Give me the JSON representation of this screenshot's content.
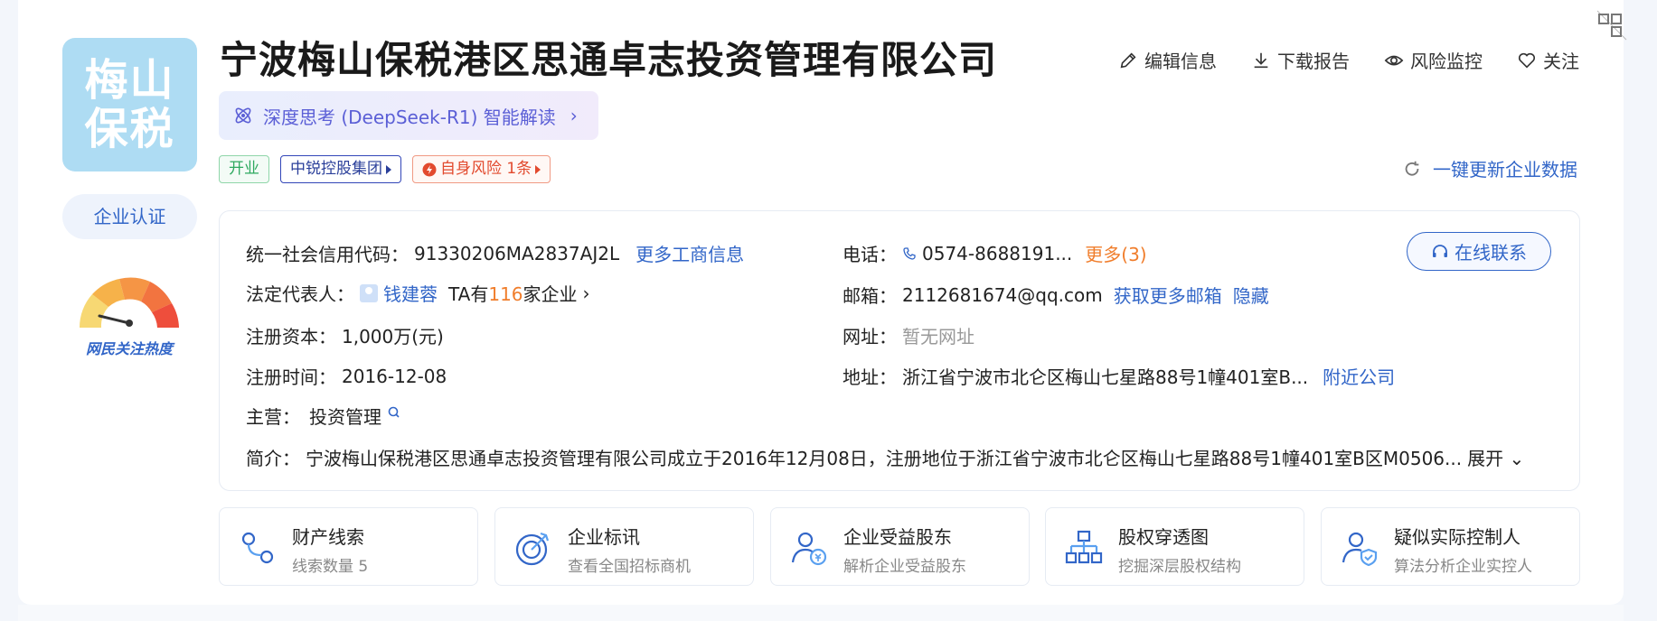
{
  "company": {
    "logo_text_line1": "梅山",
    "logo_text_line2": "保税",
    "name": "宁波梅山保税港区思通卓志投资管理有限公司",
    "certification": "企业认证",
    "heat_label": "网民关注热度"
  },
  "actions": {
    "edit": "编辑信息",
    "download": "下载报告",
    "monitor": "风险监控",
    "follow": "关注"
  },
  "ai_pill": {
    "label": "深度思考 (DeepSeek-R1) 智能解读"
  },
  "tags": {
    "status": "开业",
    "group": "中锐控股集团",
    "risk": "自身风险 1条"
  },
  "refresh": {
    "label": "一键更新企业数据"
  },
  "info": {
    "credit_code_label": "统一社会信用代码：",
    "credit_code": "91330206MA2837AJ2L",
    "more_business": "更多工商信息",
    "legal_rep_label": "法定代表人：",
    "legal_rep": "钱建蓉",
    "ta_prefix": "TA有",
    "ta_count": "116",
    "ta_suffix": "家企业",
    "capital_label": "注册资本：",
    "capital": "1,000万(元)",
    "reg_date_label": "注册时间：",
    "reg_date": "2016-12-08",
    "main_label": "主营：",
    "main_business": "投资管理",
    "phone_label": "电话：",
    "phone": "0574-8688191...",
    "phone_more": "更多(3)",
    "email_label": "邮箱：",
    "email": "2112681674@qq.com",
    "email_more": "获取更多邮箱",
    "email_hide": "隐藏",
    "website_label": "网址：",
    "website": "暂无网址",
    "address_label": "地址：",
    "address": "浙江省宁波市北仑区梅山七星路88号1幢401室B...",
    "nearby": "附近公司",
    "intro_label": "简介：",
    "intro": "宁波梅山保税港区思通卓志投资管理有限公司成立于2016年12月08日，注册地位于浙江省宁波市北仑区梅山七星路88号1幢401室B区M0506...",
    "expand": "展开",
    "contact_online": "在线联系"
  },
  "features": [
    {
      "title": "财产线索",
      "subtitle": "线索数量 5"
    },
    {
      "title": "企业标讯",
      "subtitle": "查看全国招标商机"
    },
    {
      "title": "企业受益股东",
      "subtitle": "解析企业受益股东"
    },
    {
      "title": "股权穿透图",
      "subtitle": "挖掘深层股权结构"
    },
    {
      "title": "疑似实际控制人",
      "subtitle": "算法分析企业实控人"
    }
  ],
  "colors": {
    "link_blue": "#3266c8",
    "logo_bg": "#aedcf3",
    "risk_red": "#e24a2e",
    "status_green": "#2fa960",
    "accent_orange": "#f07d2b"
  },
  "heat_level": 0.25
}
